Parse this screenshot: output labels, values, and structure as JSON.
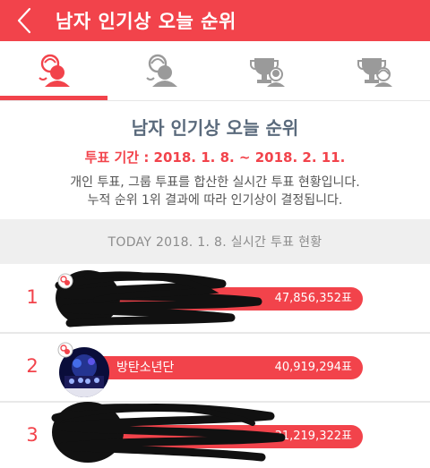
{
  "header": {
    "title": "남자 인기상 오늘 순위"
  },
  "tabs": [
    {
      "name": "male-popularity",
      "active": true
    },
    {
      "name": "female-popularity",
      "active": false
    },
    {
      "name": "male-group-award",
      "active": false
    },
    {
      "name": "female-group-award",
      "active": false
    }
  ],
  "info": {
    "title": "남자 인기상 오늘 순위",
    "period": "투표 기간 : 2018. 1. 8. ~ 2018. 2. 11.",
    "desc_line1": "개인 투표, 그룹 투표를 합산한 실시간 투표 현황입니다.",
    "desc_line2": "누적 순위 1위 결과에 따라 인기상이 결정됩니다."
  },
  "today": {
    "label": "TODAY 2018. 1. 8. 실시간 투표 현황"
  },
  "rankings": [
    {
      "rank": "1",
      "name": "",
      "votes": "47,856,352표"
    },
    {
      "rank": "2",
      "name": "방탄소년단",
      "votes": "40,919,294표"
    },
    {
      "rank": "3",
      "name": "",
      "votes": "31,219,322표"
    }
  ],
  "colors": {
    "accent": "#f2434b",
    "title_text": "#5a6a7c",
    "today_bg": "#efefef"
  }
}
